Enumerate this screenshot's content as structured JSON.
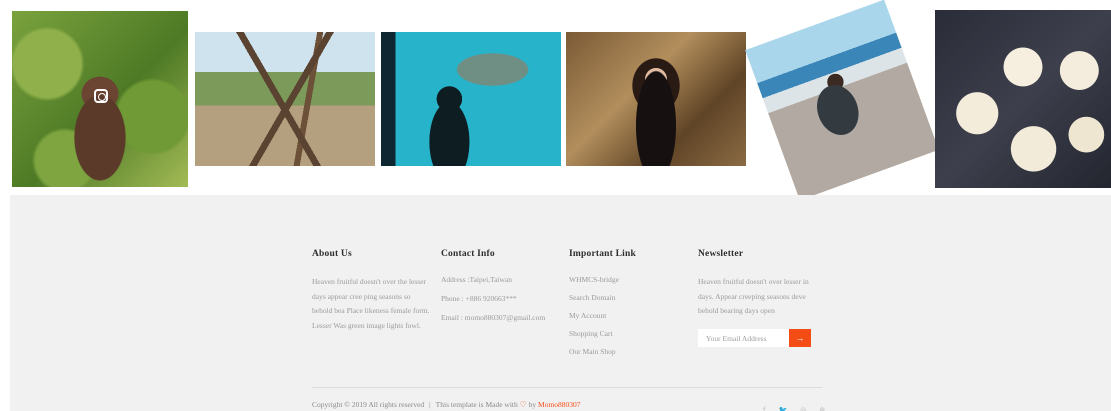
{
  "gallery": {
    "photos": [
      {
        "icon": "instagram-icon"
      },
      {},
      {},
      {},
      {},
      {}
    ]
  },
  "footer": {
    "about": {
      "title": "About Us",
      "text": "Heaven fruitful doesn't over the lesser days appear cree ping seasons so behold bea Place likeness female form. Lesser Was green image lights fowl."
    },
    "contact": {
      "title": "Contact Info",
      "address": "Address :Taipei,Taiwan",
      "phone": "Phone : +886 920663***",
      "email": "Email : momo880307@gmail.com"
    },
    "links": {
      "title": "Important Link",
      "items": [
        "WHMCS-bridge",
        "Search Domain",
        "My Account",
        "Shopping Cart",
        "Our Main Shop"
      ]
    },
    "newsletter": {
      "title": "Newsletter",
      "text": "Heaven fruitful doesn't over lesser in days. Appear creeping seasons deve behold bearing days open",
      "placeholder": "Your Email Address",
      "button_icon": "arrow-right-icon",
      "button_glyph": "→"
    },
    "copyright": {
      "text": "Copyright © 2019 All rights reserved",
      "separator": "|",
      "made_with": "This template is Made with",
      "heart": "♡",
      "by": "by",
      "author": "Momo880307"
    },
    "socials": [
      {
        "icon": "facebook-icon",
        "glyph": "f"
      },
      {
        "icon": "twitter-icon",
        "glyph": "🐦"
      },
      {
        "icon": "instagram-icon",
        "glyph": "◎"
      },
      {
        "icon": "skype-icon",
        "glyph": "⊛"
      }
    ],
    "colors": {
      "accent": "#f34d15",
      "footer_bg": "#f1f1f1"
    }
  }
}
